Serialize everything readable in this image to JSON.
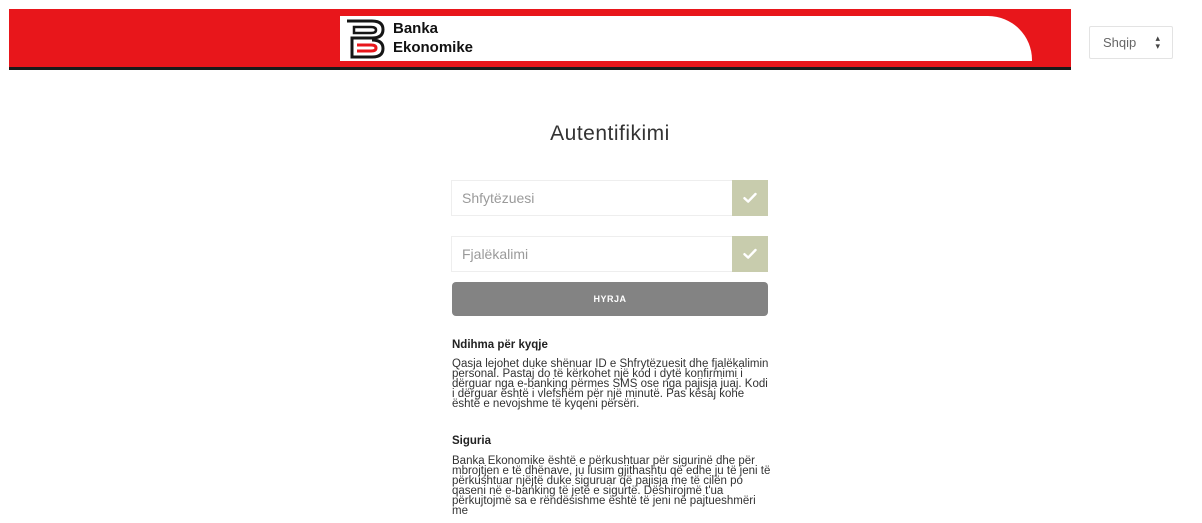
{
  "header": {
    "brand_line1": "Banka",
    "brand_line2": "Ekonomike",
    "colors": {
      "brand_red": "#e8161b",
      "rule": "#1a1a1a"
    }
  },
  "language_select": {
    "selected": "Shqip",
    "arrow_icon": "updown-arrow-icon"
  },
  "login": {
    "title": "Autentifikimi",
    "username_placeholder": "Shfytëzuesi",
    "password_placeholder": "Fjalëkalimi",
    "valid_icon": "checkmark-icon",
    "submit_label": "HYRJA",
    "colors": {
      "check_bg": "#c8ccad",
      "button_bg": "#838383"
    }
  },
  "help": {
    "heading": "Ndihma për kyqje",
    "text": "Qasja lejohet duke shënuar ID e Shfrytëzuesit dhe fjalëkalimin personal. Pastaj do të kërkohet një kod i dytë konfirmimi i dërguar nga e-banking përmes SMS ose nga pajisja juaj. Kodi i dërguar është i vlefshëm për një minutë. Pas kësaj kohe është e nevojshme të kyqeni përsëri."
  },
  "security": {
    "heading": "Siguria",
    "text": "Banka Ekonomike është e përkushtuar për sigurinë dhe për mbrojtjen e të dhënave, ju lusim gjithashtu që edhe ju të jeni të përkushtuar njëjtë duke siguruar që pajisja me të cilën po qaseni në e-banking të jetë e sigurtë. Dëshirojmë t'ua përkujtojmë sa e rëndësishme është të jeni në pajtueshmëri me"
  }
}
